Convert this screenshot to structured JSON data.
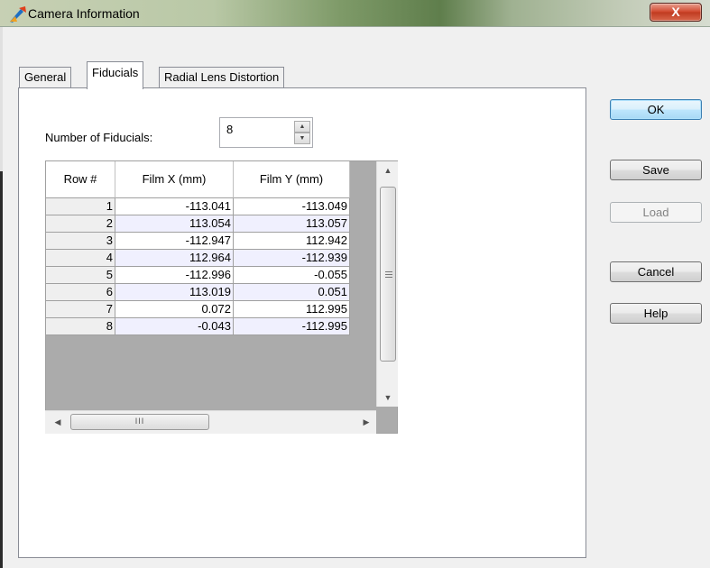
{
  "window": {
    "title": "Camera Information",
    "close_label": "X"
  },
  "tabs": [
    {
      "label": "General"
    },
    {
      "label": "Fiducials"
    },
    {
      "label": "Radial Lens Distortion"
    }
  ],
  "fiducials": {
    "count_label": "Number of Fiducials:",
    "count_value": "8",
    "columns": [
      "Row #",
      "Film X (mm)",
      "Film Y (mm)"
    ],
    "rows": [
      [
        "1",
        "-113.041",
        "-113.049"
      ],
      [
        "2",
        "113.054",
        "113.057"
      ],
      [
        "3",
        "-112.947",
        "112.942"
      ],
      [
        "4",
        "112.964",
        "-112.939"
      ],
      [
        "5",
        "-112.996",
        "-0.055"
      ],
      [
        "6",
        "113.019",
        "0.051"
      ],
      [
        "7",
        "0.072",
        "112.995"
      ],
      [
        "8",
        "-0.043",
        "-112.995"
      ]
    ],
    "hscroll_thumb_label": "III"
  },
  "buttons": {
    "ok": "OK",
    "save": "Save",
    "load": "Load",
    "cancel": "Cancel",
    "help": "Help"
  },
  "colors": {
    "row_odd": "#ffffff",
    "row_even": "#f0f0fe",
    "ok_border": "#3c7fb1"
  }
}
